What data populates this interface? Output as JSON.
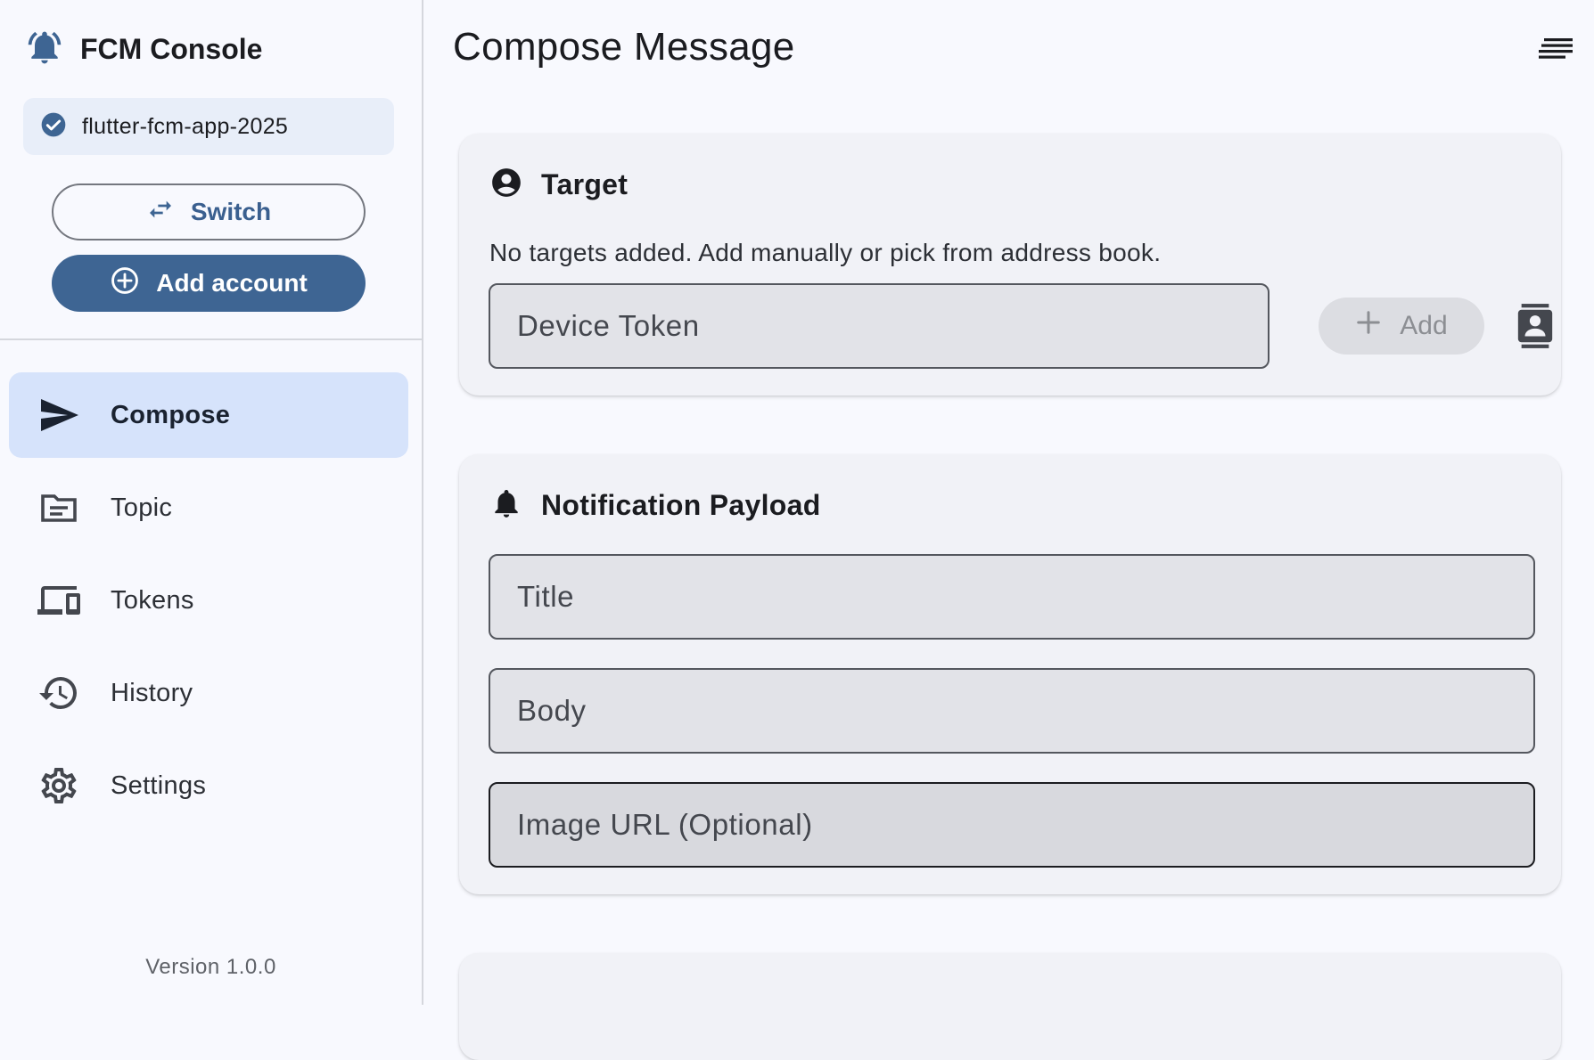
{
  "app": {
    "title": "FCM Console"
  },
  "project": {
    "name": "flutter-fcm-app-2025"
  },
  "account_actions": {
    "switch_label": "Switch",
    "add_label": "Add account"
  },
  "nav": {
    "items": [
      {
        "label": "Compose",
        "icon": "send-icon",
        "active": true
      },
      {
        "label": "Topic",
        "icon": "topic-icon",
        "active": false
      },
      {
        "label": "Tokens",
        "icon": "devices-icon",
        "active": false
      },
      {
        "label": "History",
        "icon": "history-icon",
        "active": false
      },
      {
        "label": "Settings",
        "icon": "gear-icon",
        "active": false
      }
    ]
  },
  "version": "Version 1.0.0",
  "page": {
    "title": "Compose Message"
  },
  "target": {
    "title": "Target",
    "empty_note": "No targets added. Add manually or pick from address book.",
    "token_placeholder": "Device Token",
    "add_label": "Add"
  },
  "notification": {
    "title": "Notification Payload",
    "title_placeholder": "Title",
    "body_placeholder": "Body",
    "image_placeholder": "Image URL (Optional)"
  },
  "colors": {
    "accent": "#3e6593",
    "active_nav": "#d6e3fb",
    "background": "#f8f9fe",
    "card": "#f1f2f7"
  }
}
